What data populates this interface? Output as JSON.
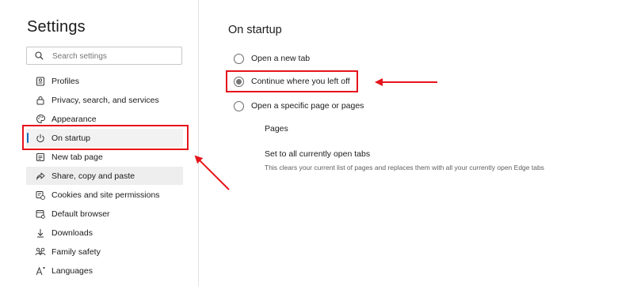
{
  "sidebar": {
    "title": "Settings",
    "search": {
      "placeholder": "Search settings",
      "value": ""
    },
    "items": [
      {
        "label": "Profiles",
        "icon": "profile-card-icon"
      },
      {
        "label": "Privacy, search, and services",
        "icon": "lock-icon"
      },
      {
        "label": "Appearance",
        "icon": "palette-icon"
      },
      {
        "label": "On startup",
        "icon": "power-icon",
        "selected": true
      },
      {
        "label": "New tab page",
        "icon": "new-tab-icon"
      },
      {
        "label": "Share, copy and paste",
        "icon": "share-icon",
        "hover": true
      },
      {
        "label": "Cookies and site permissions",
        "icon": "cookies-icon"
      },
      {
        "label": "Default browser",
        "icon": "browser-icon"
      },
      {
        "label": "Downloads",
        "icon": "download-icon"
      },
      {
        "label": "Family safety",
        "icon": "family-icon"
      },
      {
        "label": "Languages",
        "icon": "language-icon"
      }
    ]
  },
  "main": {
    "title": "On startup",
    "options": [
      {
        "label": "Open a new tab",
        "checked": false
      },
      {
        "label": "Continue where you left off",
        "checked": true
      },
      {
        "label": "Open a specific page or pages",
        "checked": false
      }
    ],
    "pages_label": "Pages",
    "set_all_title": "Set to all currently open tabs",
    "set_all_desc": "This clears your current list of pages and replaces them with all your currently open Edge tabs"
  },
  "colors": {
    "accent": "#0f6cbd",
    "annotation_red": "#e5141c"
  }
}
